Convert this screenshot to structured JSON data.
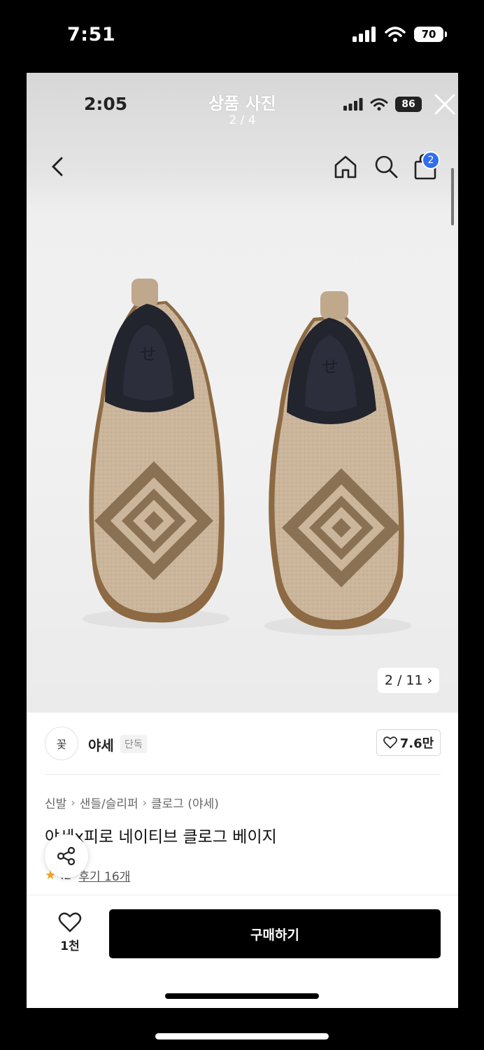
{
  "outer_status": {
    "time": "7:51",
    "battery": "70"
  },
  "viewer": {
    "inner_time": "2:05",
    "inner_battery": "86",
    "title": "상품 사진",
    "counter": "2 / 4"
  },
  "nav": {
    "cart_badge": "2"
  },
  "image_indicator": {
    "text": "2 / 11",
    "chevron": "›"
  },
  "brand": {
    "logo_text": "꽃",
    "name": "야세",
    "tag": "단독",
    "likes": "7.6만"
  },
  "breadcrumb": [
    "신발",
    "샌들/슬리퍼",
    "클로그 (야세)"
  ],
  "breadcrumb_sep": "›",
  "product": {
    "title": "야세x피로 네이티브 클로그 베이지",
    "rating": ".2",
    "reviews": "후기 16개"
  },
  "bottom": {
    "wish_count": "1천",
    "buy_label": "구매하기"
  },
  "colors": {
    "accent": "#2f6ef0",
    "buy_button": "#000000",
    "shoe": "#c9b49a",
    "pattern": "#8a7154"
  },
  "icons": [
    "signal-icon",
    "wifi-icon",
    "battery-icon",
    "close-icon",
    "back-icon",
    "home-icon",
    "search-icon",
    "bag-icon",
    "heart-icon",
    "share-icon",
    "star-icon"
  ]
}
